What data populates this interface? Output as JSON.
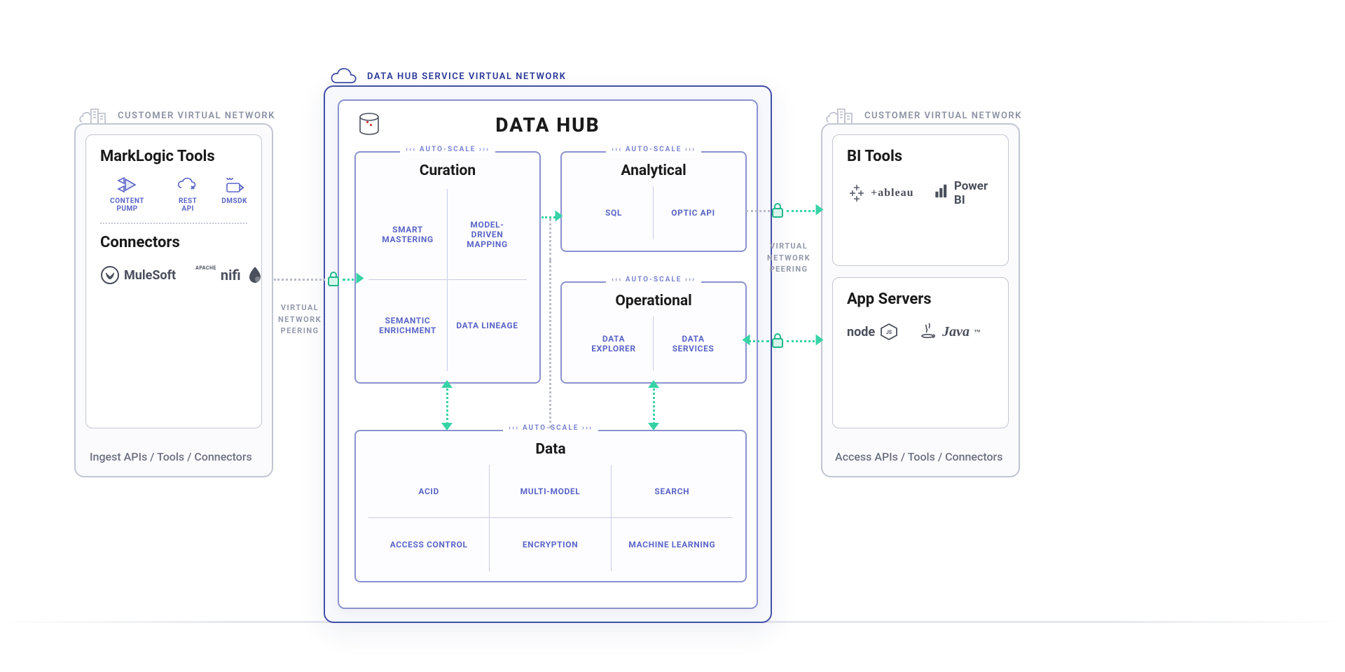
{
  "networks": {
    "left_label": "CUSTOMER VIRTUAL NETWORK",
    "center_label": "DATA HUB SERVICE VIRTUAL NETWORK",
    "right_label": "CUSTOMER VIRTUAL NETWORK"
  },
  "left_panel": {
    "tools_title": "MarkLogic Tools",
    "tools": [
      {
        "label": "CONTENT PUMP",
        "icon": "content-pump"
      },
      {
        "label": "REST API",
        "icon": "rest-api"
      },
      {
        "label": "DMSDK",
        "icon": "dmsdk"
      }
    ],
    "connectors_title": "Connectors",
    "connectors": [
      {
        "name": "MuleSoft",
        "brand": "mulesoft"
      },
      {
        "name": "nifi",
        "brand": "nifi",
        "superscript": "APACHE"
      }
    ],
    "caption": "Ingest APIs / Tools / Connectors"
  },
  "right_panel": {
    "bi_title": "BI Tools",
    "bi_tools": [
      {
        "name": "+ableau",
        "brand": "tableau"
      },
      {
        "name": "Power BI",
        "brand": "powerbi"
      }
    ],
    "app_title": "App Servers",
    "app_servers": [
      {
        "name": "node",
        "brand": "node",
        "suffix": "JS"
      },
      {
        "name": "Java",
        "brand": "java",
        "tm": "™"
      }
    ],
    "caption": "Access APIs / Tools / Connectors"
  },
  "hub": {
    "title": "DATA HUB",
    "autoscale_label": "AUTO-SCALE",
    "curation": {
      "title": "Curation",
      "cells": [
        "SMART MASTERING",
        "MODEL-DRIVEN MAPPING",
        "SEMANTIC ENRICHMENT",
        "DATA LINEAGE"
      ]
    },
    "analytical": {
      "title": "Analytical",
      "cells": [
        "SQL",
        "OPTIC API"
      ]
    },
    "operational": {
      "title": "Operational",
      "cells": [
        "DATA EXPLORER",
        "DATA SERVICES"
      ]
    },
    "data": {
      "title": "Data",
      "cells": [
        "ACID",
        "MULTI-MODEL",
        "SEARCH",
        "ACCESS CONTROL",
        "ENCRYPTION",
        "MACHINE LEARNING"
      ]
    }
  },
  "peering_label": "VIRTUAL NETWORK PEERING",
  "colors": {
    "accent_blue": "#5a65c7",
    "frame_purple": "#434fa8",
    "teal": "#36d3a6",
    "gray_border": "#c2c6d2",
    "text_dark": "#1a1a1a",
    "text_muted": "#8b91a3"
  }
}
